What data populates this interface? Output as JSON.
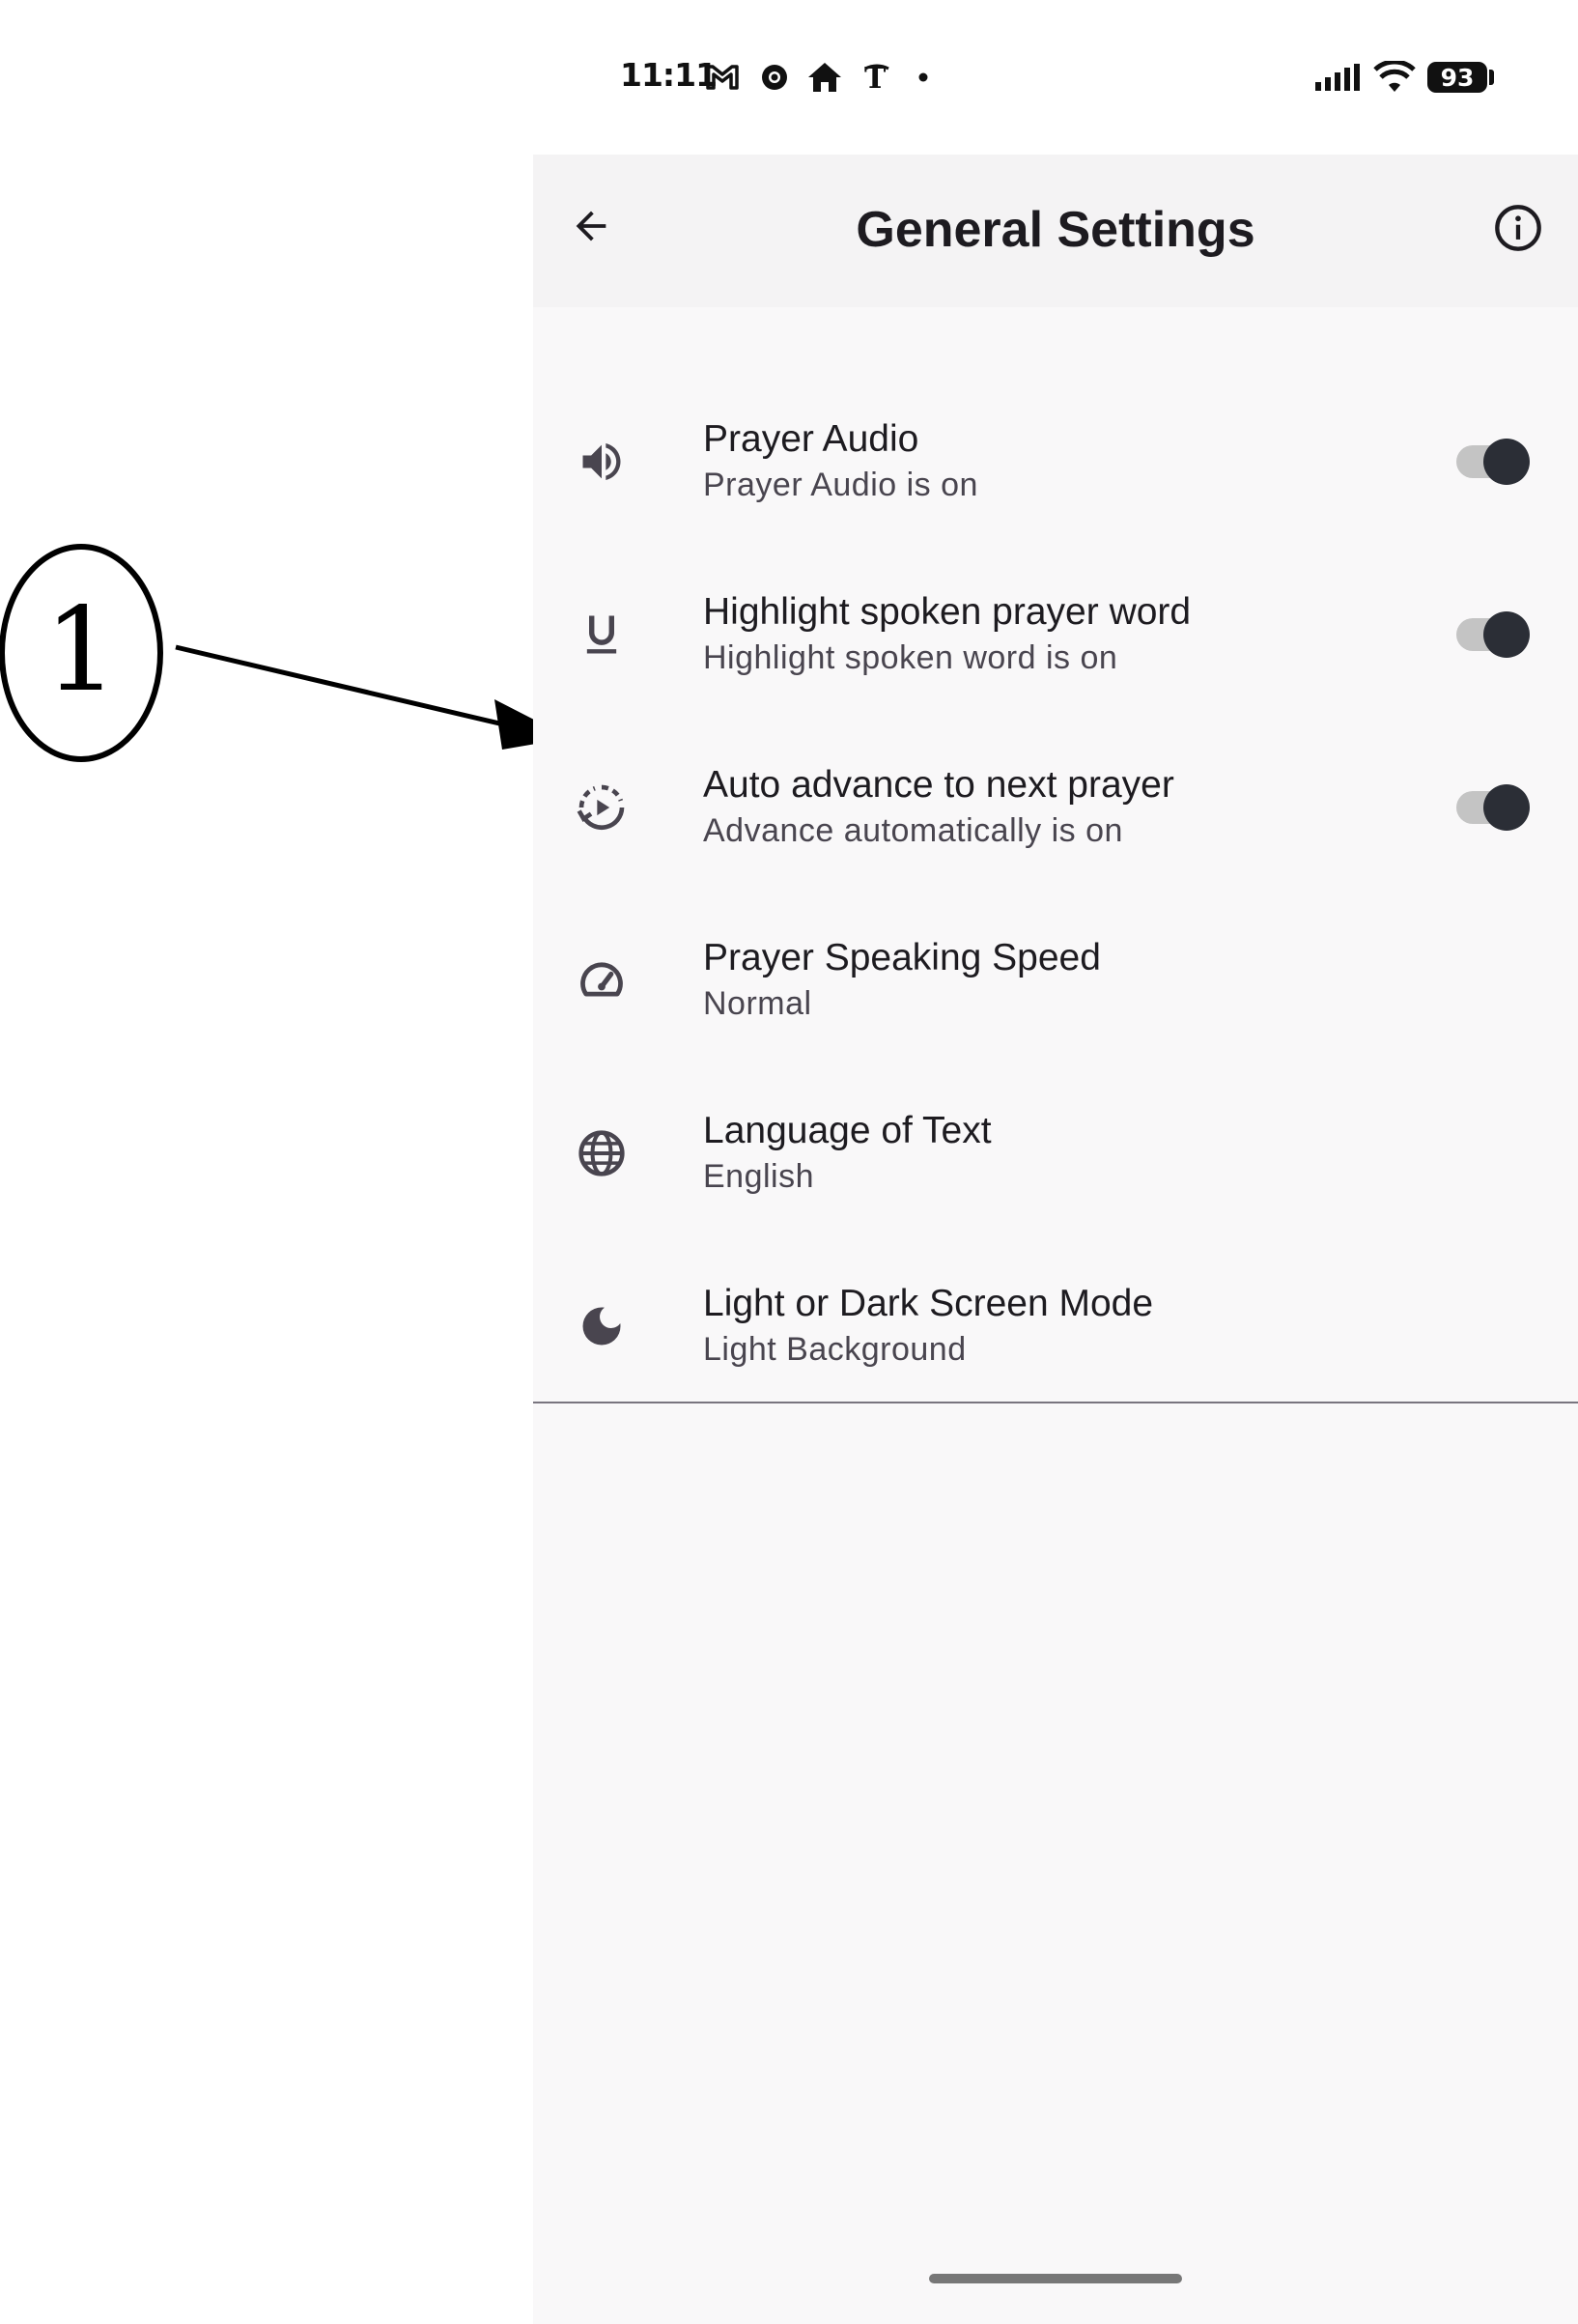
{
  "annotation": {
    "label": "1"
  },
  "status_bar": {
    "time": "11:11",
    "icons": [
      "gmail-icon",
      "chrome-icon",
      "home-icon",
      "nytimes-icon",
      "dot-icon"
    ],
    "battery_level": "93",
    "signal_icon": "signal-icon",
    "wifi_icon": "wifi-icon"
  },
  "header": {
    "title": "General Settings",
    "back_icon": "arrow-back-icon",
    "info_icon": "info-icon"
  },
  "settings": [
    {
      "title": "Prayer Audio",
      "subtitle": "Prayer Audio is on",
      "icon": "volume-icon",
      "toggle": true
    },
    {
      "title": "Highlight spoken prayer word",
      "subtitle": "Highlight spoken word is on",
      "icon": "underline-icon",
      "toggle": true
    },
    {
      "title": "Auto advance to next prayer",
      "subtitle": "Advance automatically is on",
      "icon": "auto-play-icon",
      "toggle": true
    },
    {
      "title": "Prayer Speaking Speed",
      "subtitle": "Normal",
      "icon": "speedometer-icon",
      "toggle": false
    },
    {
      "title": "Language of Text",
      "subtitle": "English",
      "icon": "globe-icon",
      "toggle": false
    },
    {
      "title": "Light or Dark Screen Mode",
      "subtitle": "Light Background",
      "icon": "moon-icon",
      "toggle": false
    }
  ],
  "colors": {
    "app_background": "#f9f8f9",
    "top_bar_background": "#f4f3f4",
    "toggle_thumb": "#2b2e36",
    "toggle_track": "#c4c4c4",
    "icon_color": "#49454f"
  }
}
